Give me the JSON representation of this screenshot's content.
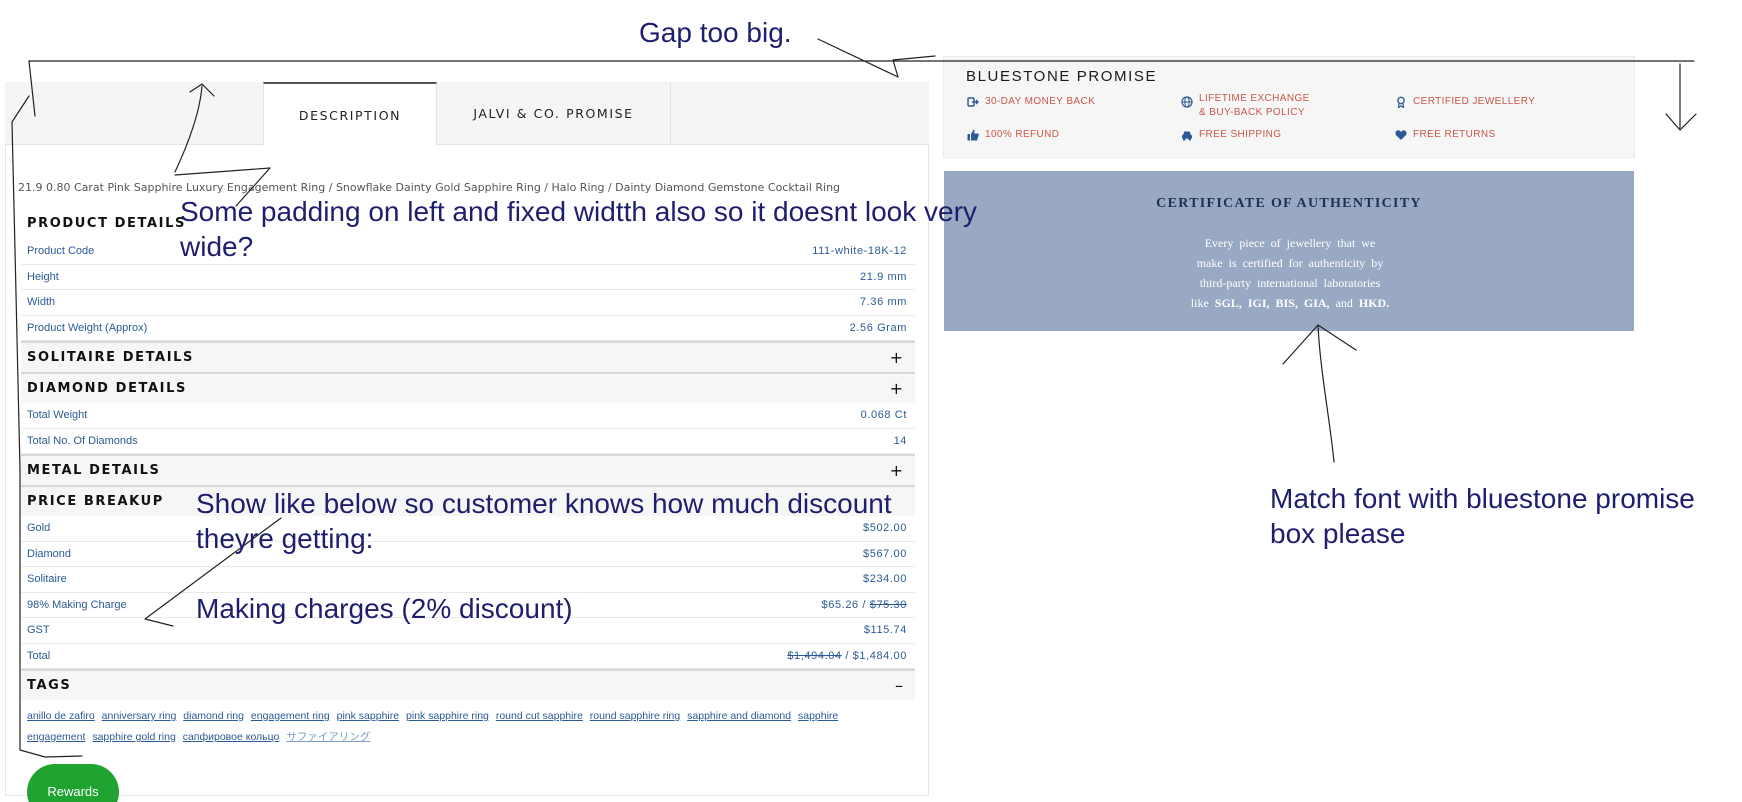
{
  "tabs": [
    {
      "label": "DESCRIPTION",
      "active": true
    },
    {
      "label": "JALVI & CO. PROMISE",
      "active": false
    }
  ],
  "breadcrumb": "21.9 0.80 Carat Pink Sapphire Luxury Engagement Ring / Snowflake Dainty Gold Sapphire Ring / Halo Ring / Dainty Diamond Gemstone Cocktail Ring",
  "product_details": {
    "title": "PRODUCT DETAILS",
    "rows": [
      {
        "label": "Product Code",
        "value": "111-white-18K-12"
      },
      {
        "label": "Height",
        "value": "21.9 mm"
      },
      {
        "label": "Width",
        "value": "7.36 mm"
      },
      {
        "label": "Product Weight (Approx)",
        "value": "2.56 Gram"
      }
    ]
  },
  "solitaire_details": {
    "title": "SOLITAIRE DETAILS",
    "toggle": "+"
  },
  "diamond_details": {
    "title": "DIAMOND DETAILS",
    "toggle": "+",
    "rows": [
      {
        "label": "Total Weight",
        "value": "0.068 Ct"
      },
      {
        "label": "Total No. Of Diamonds",
        "value": "14"
      }
    ]
  },
  "metal_details": {
    "title": "METAL DETAILS",
    "toggle": "+"
  },
  "price_breakup": {
    "title": "PRICE BREAKUP",
    "rows": [
      {
        "label": "Gold",
        "value": "$502.00"
      },
      {
        "label": "Diamond",
        "value": "$567.00"
      },
      {
        "label": "Solitaire",
        "value": "$234.00"
      },
      {
        "label": "98% Making Charge",
        "value": "$65.26",
        "separator": " / ",
        "value_strike": "$75.30"
      },
      {
        "label": "GST",
        "value": "$115.74"
      },
      {
        "label": "Total",
        "value_strike": "$1,494.04",
        "separator": " / ",
        "value": "$1,484.00"
      }
    ]
  },
  "tags": {
    "title": "TAGS",
    "toggle": "–",
    "items": [
      "anillo de zafiro",
      "anniversary ring",
      "diamond ring",
      "engagement ring",
      "pink sapphire",
      "pink sapphire ring",
      "round cut sapphire",
      "round sapphire ring",
      "sapphire and diamond",
      "sapphire engagement",
      "sapphire gold ring",
      "сапфировое кольцо"
    ],
    "last_item": "サファイアリング"
  },
  "rewards_button": "Rewards",
  "promise": {
    "title": "BLUESTONE PROMISE",
    "items": [
      {
        "icon": "money-back-icon",
        "text": "30-DAY MONEY BACK"
      },
      {
        "icon": "globe-icon",
        "line1": "LIFETIME EXCHANGE",
        "line2": "& BUY-BACK POLICY"
      },
      {
        "icon": "certificate-icon",
        "text": "CERTIFIED JEWELLERY"
      },
      {
        "icon": "thumbs-up-icon",
        "text": "100% REFUND"
      },
      {
        "icon": "truck-icon",
        "text": "FREE SHIPPING"
      },
      {
        "icon": "heart-icon",
        "text": "FREE RETURNS"
      }
    ],
    "accent": "#c9574a"
  },
  "certificate": {
    "title": "CERTIFICATE OF AUTHENTICITY",
    "lines": [
      "Every piece of jewellery that we",
      "make is certified for authenticity by",
      "third-party international laboratories"
    ],
    "last_prefix": "like ",
    "labs": [
      "SGL,",
      "IGI,",
      "BIS,",
      "GIA,"
    ],
    "and_word": "and",
    "last_lab": "HKD.",
    "background": "#99a9c3"
  },
  "annotations": {
    "gap": "Gap too big.",
    "padding_line1": "Some padding on left and fixed widtth also so it doesnt look very",
    "padding_line2": "wide?",
    "discount_line1": "Show like below so customer knows how much discount",
    "discount_line2": "theyre getting:",
    "discount_line3": "Making charges (2% discount)",
    "font_line1": "Match font with bluestone promise",
    "font_line2": "box please",
    "color": "#1e1e6e"
  }
}
